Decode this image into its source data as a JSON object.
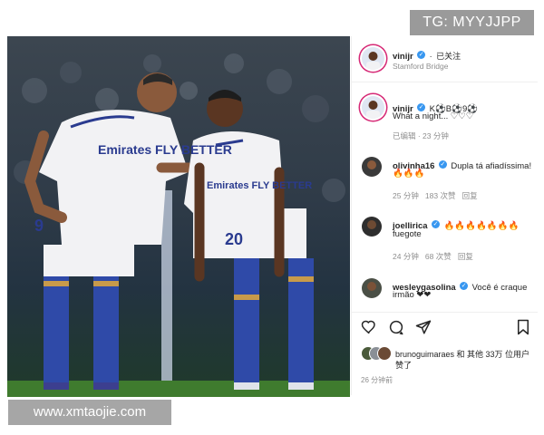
{
  "watermarks": {
    "top": "TG: MYYJJPP",
    "bottom": "www.xmtaojie.com"
  },
  "post": {
    "author": "vinijr",
    "follow_status": "已关注",
    "location": "Stamford Bridge",
    "caption_user": "vinijr",
    "caption_line1": "K⚽B⚽9⚽",
    "caption_line2": "What a night... ♡♡♡",
    "caption_meta": "已编辑 · 23 分钟"
  },
  "comments": [
    {
      "user": "olivinha16",
      "text": "Dupla tá afiadíssima!",
      "emoji": "🔥🔥🔥",
      "time": "25 分钟",
      "likes": "183 次赞",
      "reply": "回复"
    },
    {
      "user": "joellirica",
      "text": "🔥🔥🔥🔥🔥🔥🔥",
      "emoji": "fuegote",
      "time": "24 分钟",
      "likes": "68 次赞",
      "reply": "回复"
    },
    {
      "user": "wesleygasolina",
      "text": "Você é craque",
      "emoji": "irmão ❤❤",
      "time": "",
      "likes": "",
      "reply": ""
    }
  ],
  "likes_line1": "brunoguimaraes 和 其他 33万 位用户",
  "likes_line2": "赞了",
  "post_time": "26 分钟前",
  "jersey": {
    "left_number": "9",
    "right_number": "20",
    "sponsor": "Emirates FLY BETTER"
  },
  "colors": {
    "verified": "#3897f0",
    "story_ring": "#d62976",
    "kit_white": "#f2f2f4",
    "kit_navy": "#2a3b8f"
  }
}
